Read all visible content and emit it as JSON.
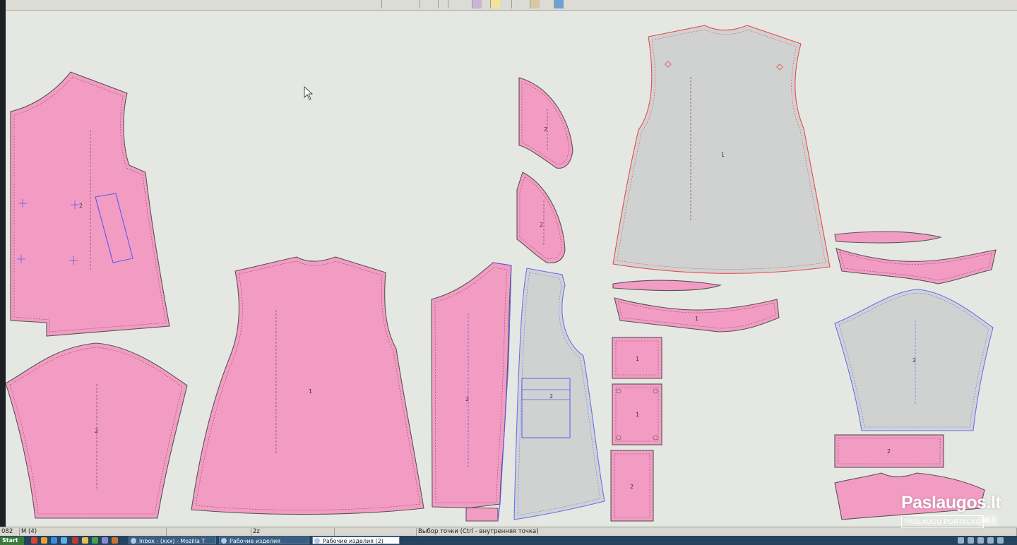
{
  "colors": {
    "workspace": "#e5e8e2",
    "piece_fill": "#f39cc3",
    "piece_outline": "#555555",
    "selected_fill": "#d0d2d2",
    "selected_outline_red": "#e84a4a",
    "selected_outline_blue": "#6a6ff0",
    "bezel": "#1c1f24",
    "taskbar": "#24435f"
  },
  "icons": [
    "cursor-arrow-icon",
    "toolbar-button-icon",
    "start-icon",
    "browser-icon",
    "folder-icon",
    "pattern-app-icon"
  ],
  "pieces": {
    "back_left": "2",
    "sleeve_left": "2",
    "front_center": "1",
    "armhole_facing_top": "2",
    "armhole_facing_bottom": "2",
    "front_panel": "2",
    "front_panel_pocket": "2",
    "front_large_selected": "1",
    "neck_facing": "1",
    "pocket_square_a": "1",
    "pocket_square_b": "1",
    "pocket_square_c": "2",
    "sleeve_right_selected": "2",
    "cuff_band": "2"
  },
  "statusbar": {
    "coord": "082",
    "mode": "M (4)",
    "scale": "2z",
    "hint": "Выбор точки (Ctrl - внутренняя точка)"
  },
  "taskbar": {
    "start_label": "Start",
    "tasks": [
      {
        "label": "Inbox - (xxx) - Mozilla T"
      },
      {
        "label": "Рабочие изделия"
      },
      {
        "label": "Рабочие изделия (2)"
      }
    ]
  },
  "watermark": {
    "logo": "Paslaugos.lt",
    "subtitle": "PASLAUGŲ PORTALAS",
    "rank": "Nr.1"
  }
}
